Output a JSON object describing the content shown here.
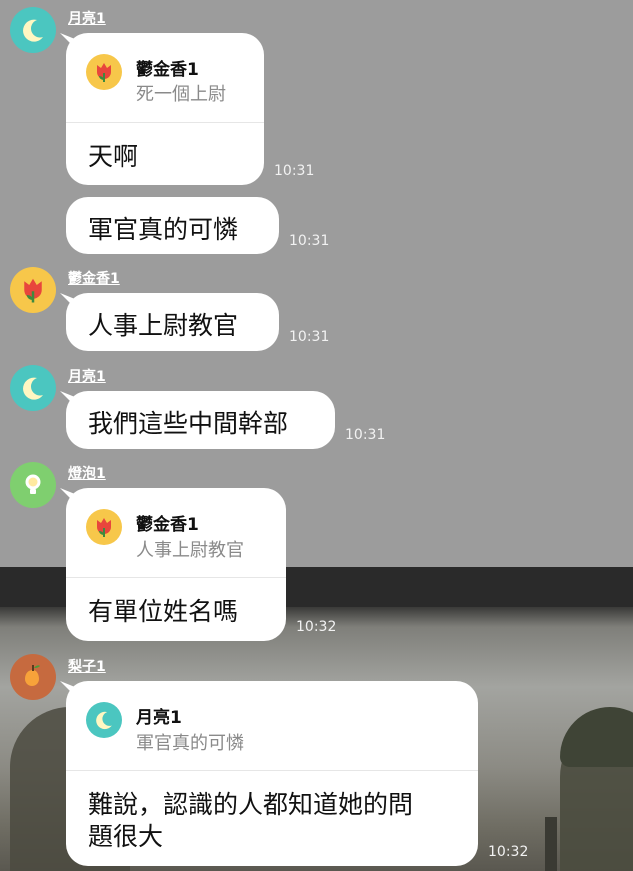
{
  "colors": {
    "background": "#9c9c9c",
    "bubble": "#ffffff",
    "moon_avatar": "#4bc6c0",
    "tulip_avatar": "#f7c74a",
    "bulb_avatar": "#7fcf6f",
    "pear_avatar": "#c66a3f"
  },
  "messages": [
    {
      "sender": "月亮1",
      "avatar": "moon-icon",
      "quote": {
        "name": "鬱金香1",
        "text": "死一個上尉",
        "avatar": "tulip-icon"
      },
      "text": "天啊",
      "time": "10:31"
    },
    {
      "text": "軍官真的可憐",
      "time": "10:31"
    },
    {
      "sender": "鬱金香1",
      "avatar": "tulip-icon",
      "text": "人事上尉教官",
      "time": "10:31"
    },
    {
      "sender": "月亮1",
      "avatar": "moon-icon",
      "text": "我們這些中間幹部",
      "time": "10:31"
    },
    {
      "sender": "燈泡1",
      "avatar": "bulb-icon",
      "quote": {
        "name": "鬱金香1",
        "text": "人事上尉教官",
        "avatar": "tulip-icon"
      },
      "text": "有單位姓名嗎",
      "time": "10:32"
    },
    {
      "sender": "梨子1",
      "avatar": "pear-icon",
      "quote": {
        "name": "月亮1",
        "text": "軍官真的可憐",
        "avatar": "moon-icon"
      },
      "text_line1": "難說，認識的人都知道她的問",
      "text_line2": "題很大",
      "time": "10:32"
    }
  ]
}
